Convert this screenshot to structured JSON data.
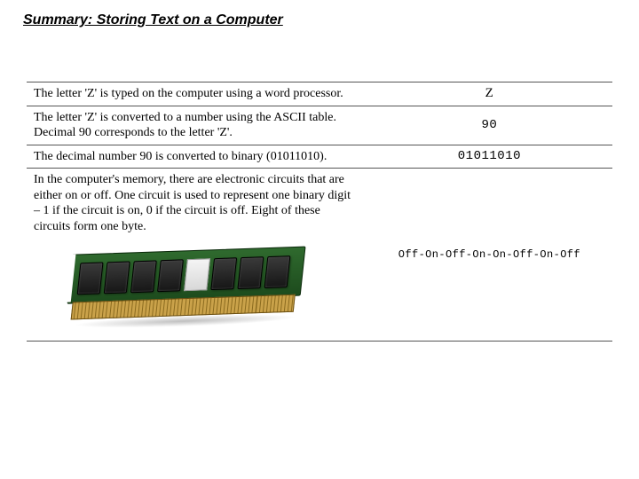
{
  "heading": "Summary: Storing Text on a Computer",
  "rows": [
    {
      "left": "The letter 'Z' is typed on the computer using a word processor.",
      "right": "Z"
    },
    {
      "left": "The letter 'Z' is converted to a number using the ASCII table.  Decimal 90 corresponds to the letter 'Z'.",
      "right": "90"
    },
    {
      "left": "The decimal number 90 is converted to binary (01011010).",
      "right": "01011010"
    },
    {
      "left": "In the computer's memory, there are electronic circuits that are either on or off.  One circuit is used to represent one binary digit – 1 if the circuit is on, 0 if the circuit is off.  Eight of these circuits form one byte.",
      "right": "Off-On-Off-On-On-Off-On-Off"
    }
  ]
}
